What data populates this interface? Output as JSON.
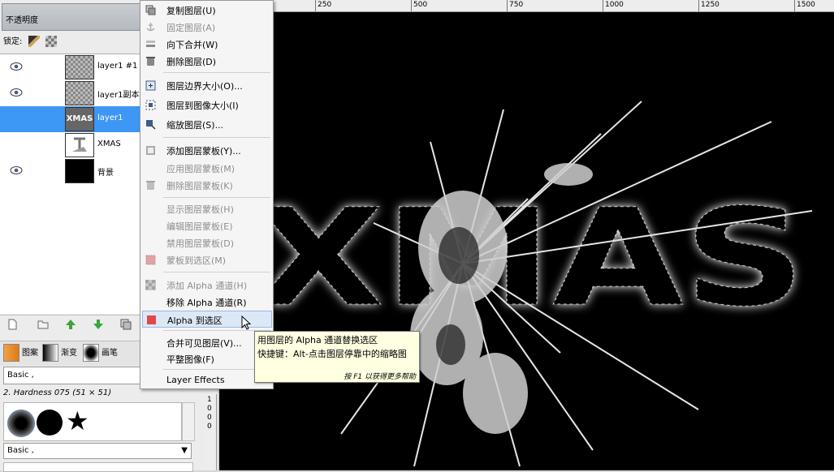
{
  "layers_panel": {
    "opacity_label": "不透明度",
    "lock_label": "锁定:",
    "layers": [
      {
        "name": "layer1 #1",
        "visible": true,
        "thumb": "checker"
      },
      {
        "name": "layer1副本",
        "visible": true,
        "thumb": "checker"
      },
      {
        "name": "layer1",
        "visible": false,
        "thumb": "xmas",
        "thumb_text": "XMAS",
        "selected": true
      },
      {
        "name": "XMAS",
        "visible": false,
        "thumb": "white"
      },
      {
        "name": "背景",
        "visible": true,
        "thumb": "black"
      }
    ]
  },
  "dock_tabs": {
    "patterns": "图案",
    "gradients": "渐变",
    "brushes": "画笔"
  },
  "brushes": {
    "filter_value": "Basic ,",
    "current_brush": "2. Hardness 075 (51 × 51)",
    "filter_value_2": "Basic ,"
  },
  "ruler": {
    "ticks": [
      "250",
      "500",
      "750",
      "1000",
      "1250",
      "1500"
    ],
    "vticks": [
      "1",
      "0",
      "0",
      "0"
    ]
  },
  "canvas": {
    "text": "XMAS"
  },
  "context_menu": {
    "items": [
      {
        "label": "复制图层(U)",
        "icon": "duplicate-icon",
        "enabled": true
      },
      {
        "label": "固定图层(A)",
        "icon": "anchor-icon",
        "enabled": false
      },
      {
        "label": "向下合并(W)",
        "icon": "merge-down-icon",
        "enabled": true
      },
      {
        "label": "删除图层(D)",
        "icon": "trash-icon",
        "enabled": true
      },
      {
        "label": "图层边界大小(O)...",
        "icon": "layer-boundary-icon",
        "enabled": true
      },
      {
        "label": "图层到图像大小(I)",
        "icon": "layer-to-image-icon",
        "enabled": true
      },
      {
        "label": "缩放图层(S)...",
        "icon": "scale-icon",
        "enabled": true
      },
      {
        "label": "添加图层蒙板(Y)...",
        "icon": "add-mask-icon",
        "enabled": true
      },
      {
        "label": "应用图层蒙板(M)",
        "icon": "",
        "enabled": false
      },
      {
        "label": "删除图层蒙板(K)",
        "icon": "trash-icon",
        "enabled": false
      },
      {
        "label": "显示图层蒙板(H)",
        "icon": "",
        "enabled": false
      },
      {
        "label": "编辑图层蒙板(E)",
        "icon": "",
        "enabled": false
      },
      {
        "label": "禁用图层蒙板(D)",
        "icon": "",
        "enabled": false
      },
      {
        "label": "蒙板到选区(M)",
        "icon": "mask-to-selection-icon",
        "enabled": false
      },
      {
        "label": "添加 Alpha 通道(H)",
        "icon": "alpha-channel-icon",
        "enabled": false
      },
      {
        "label": "移除 Alpha 通道(R)",
        "icon": "",
        "enabled": true
      },
      {
        "label": "Alpha 到选区",
        "icon": "alpha-to-selection-icon",
        "enabled": true,
        "highlighted": true
      },
      {
        "label": "合并可见图层(V)...",
        "icon": "",
        "enabled": true
      },
      {
        "label": "平整图像(F)",
        "icon": "",
        "enabled": true
      },
      {
        "label": "Layer Effects",
        "icon": "",
        "enabled": true
      }
    ]
  },
  "tooltip": {
    "line1": "用图层的 Alpha 通道替换选区",
    "line2": "快捷键：Alt-点击图层停靠中的缩略图",
    "help": "按 F1 以获得更多帮助"
  },
  "colors": {
    "selection": "#3d97f5",
    "menu_highlight": "#dde8f7",
    "tooltip_bg": "#ffffe1"
  }
}
